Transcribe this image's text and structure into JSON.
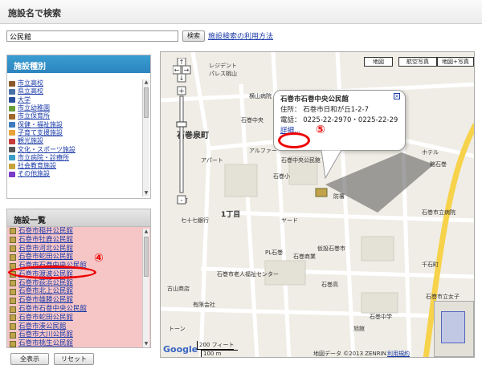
{
  "header": {
    "title": "施設名で検索"
  },
  "search": {
    "value": "公民館",
    "button": "検索",
    "help": "施設検索の利用方法"
  },
  "categories": {
    "title": "施設種別",
    "items": [
      {
        "label": "市立高校",
        "color": "#8b5a2b"
      },
      {
        "label": "県立高校",
        "color": "#4a6fa5"
      },
      {
        "label": "大学",
        "color": "#2b4e9e"
      },
      {
        "label": "市立幼稚園",
        "color": "#6b9e3a"
      },
      {
        "label": "市立保育所",
        "color": "#9e6a2a"
      },
      {
        "label": "保健・福祉施設",
        "color": "#3d7abf"
      },
      {
        "label": "子育て支援施設",
        "color": "#e8a23b"
      },
      {
        "label": "観光施設",
        "color": "#c63b3b"
      },
      {
        "label": "文化・スポーツ施設",
        "color": "#555555"
      },
      {
        "label": "市立病院・診療所",
        "color": "#3b9ec6"
      },
      {
        "label": "社会教育施設",
        "color": "#c6a23b"
      },
      {
        "label": "その他施設",
        "color": "#7a3bc6"
      }
    ]
  },
  "facilities": {
    "title": "施設一覧",
    "items": [
      "石巻市稲井公民館",
      "石巻市牡鹿公民館",
      "石巻市河北公民館",
      "石巻市蛇田公民館",
      "石巻市石巻中央公民館",
      "石巻市渡波公民館",
      "石巻市荻浜公民館",
      "石巻市北上公民館",
      "石巻市雄勝公民館",
      "石巻市石巻中央公民館",
      "石巻市蛇田公民館",
      "石巻市湊公民館",
      "石巻市大川公民館",
      "石巻市桃生公民館"
    ]
  },
  "buttons": {
    "show_all": "全表示",
    "reset": "リセット"
  },
  "annotations": {
    "n4": "④",
    "n5": "⑤"
  },
  "map": {
    "types": [
      "地図",
      "航空写真",
      "地図+写真"
    ],
    "popup": {
      "title": "石巻市石巻中央公民館",
      "address": "住所： 石巻市日和が丘1-2-7",
      "phone": "電話： 0225-22-2970・0225-22-2976",
      "detail": "詳細..."
    },
    "labels": [
      "レジデント",
      "パレス桃山",
      "横山病院",
      "石巻中央",
      "石巻泉町",
      "アパート",
      "アルファー",
      "石巻小",
      "旭町",
      "1丁目",
      "石巻中央公民館",
      "防署",
      "ヤード",
      "七十七銀行",
      "古山商店",
      "PL石巻",
      "石巻市老人福祉センター",
      "石巻商業",
      "石巻高",
      "石巻市立病院",
      "ホテル",
      "館石巻",
      "千石町",
      "石巻市立女子",
      "石巻中学",
      "仮設石巻市",
      "旭館",
      "有限会社",
      "トーン",
      "Google",
      "地図データ ©2013 ZENRIN",
      "利用規約"
    ],
    "scale": {
      "ft": "200 フィート",
      "m": "100 m"
    }
  }
}
